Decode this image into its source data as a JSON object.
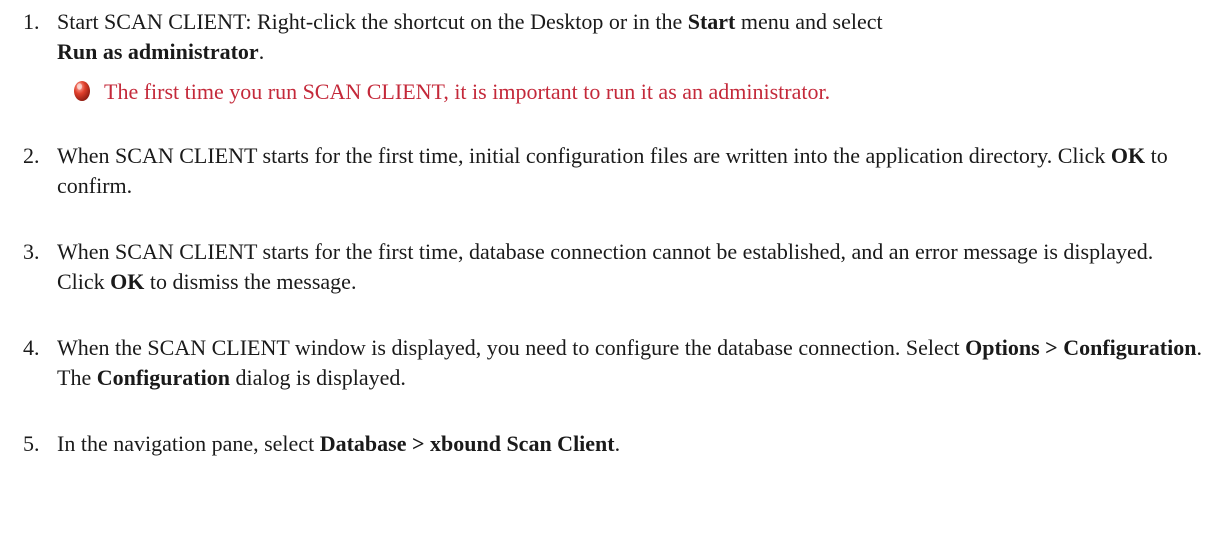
{
  "steps": [
    {
      "number": "1.",
      "parts": [
        {
          "t": "Start SCAN CLIENT: Right-click the shortcut on the Desktop or in the "
        },
        {
          "t": "Start",
          "b": true
        },
        {
          "t": " menu and select "
        },
        {
          "t": "Run as administrator",
          "b": true
        },
        {
          "t": "."
        }
      ]
    },
    {
      "number": "2.",
      "parts": [
        {
          "t": "When SCAN CLIENT starts for the first time, initial configuration files are written into the application directory. Click "
        },
        {
          "t": "OK",
          "b": true
        },
        {
          "t": " to confirm."
        }
      ]
    },
    {
      "number": "3.",
      "parts": [
        {
          "t": "When SCAN CLIENT starts for the first time, database connection cannot be established, and an error message is displayed. Click "
        },
        {
          "t": "OK",
          "b": true
        },
        {
          "t": " to dismiss the message."
        }
      ]
    },
    {
      "number": "4.",
      "parts": [
        {
          "t": "When the SCAN CLIENT window is displayed, you need to configure the database connection. Select "
        },
        {
          "t": "Options > Configuration",
          "b": true
        },
        {
          "t": ". The "
        },
        {
          "t": "Configuration",
          "b": true
        },
        {
          "t": " dialog is displayed."
        }
      ]
    },
    {
      "number": "5.",
      "parts": [
        {
          "t": "In the navigation pane, select "
        },
        {
          "t": "Database > xbound Scan Client",
          "b": true
        },
        {
          "t": "."
        }
      ]
    }
  ],
  "note": {
    "icon": "important-icon",
    "text": "The first time you run SCAN CLIENT, it is important to run it as an administrator.",
    "color": "#c4293a"
  }
}
